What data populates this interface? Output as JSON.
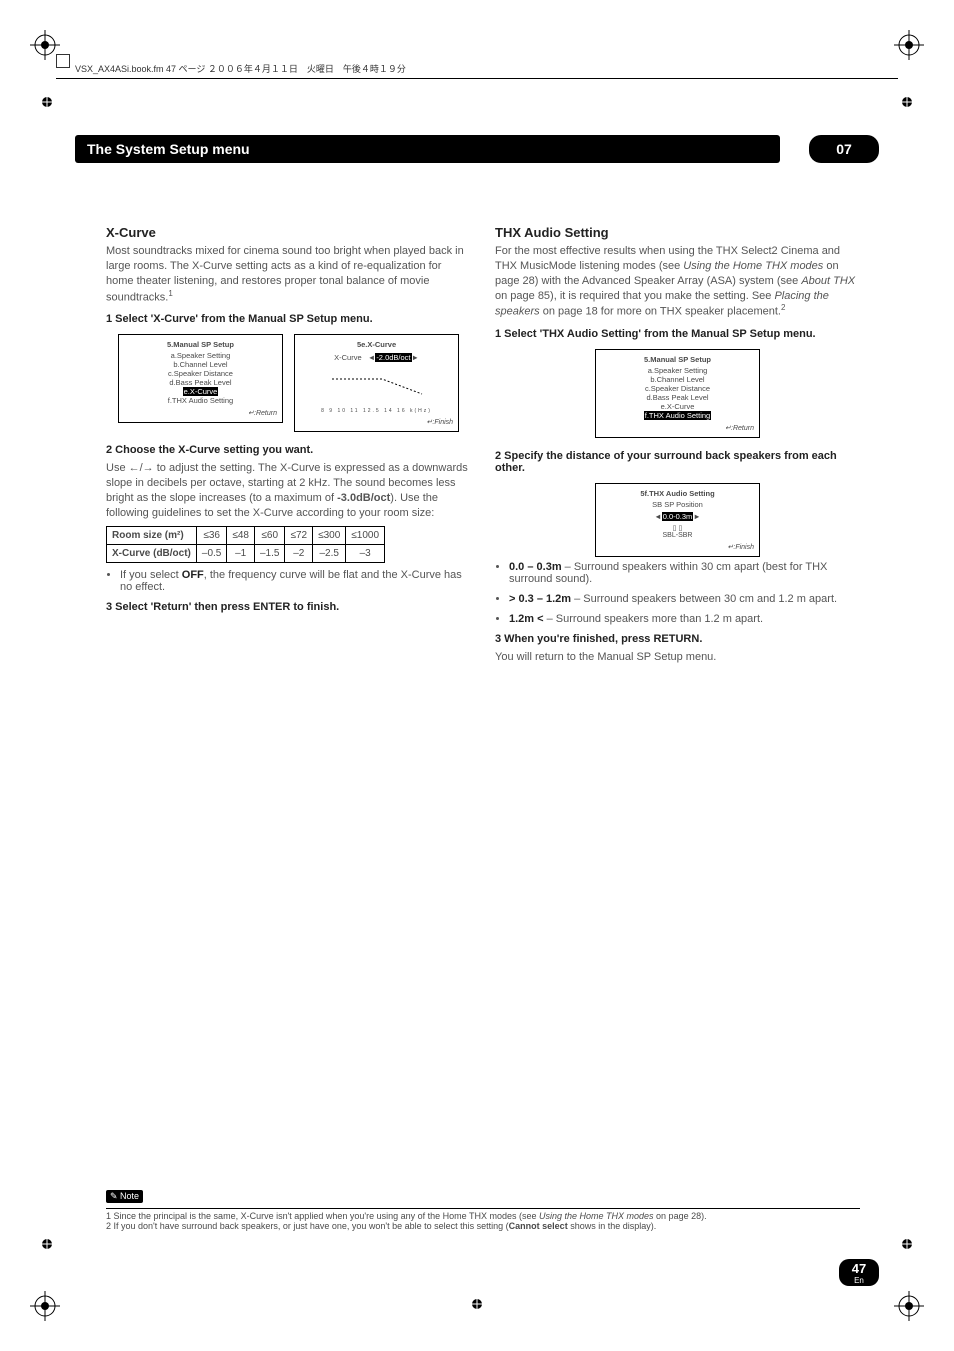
{
  "header": {
    "text": "VSX_AX4ASi.book.fm  47 ページ  ２００６年４月１１日　火曜日　午後４時１９分"
  },
  "titleBar": "The System Setup menu",
  "chapterNum": "07",
  "left": {
    "heading": "X-Curve",
    "intro": "Most soundtracks mixed for cinema sound too bright when played back in large rooms. The X-Curve setting acts as a kind of re-equalization for home theater listening, and restores proper tonal balance of movie soundtracks.",
    "introSup": "1",
    "step1": "1   Select 'X-Curve' from the Manual SP Setup menu.",
    "menu1": {
      "header": "5.Manual  SP  Setup",
      "items": [
        "a.Speaker  Setting",
        "b.Channel  Level",
        "c.Speaker  Distance",
        "d.Bass  Peak  Level",
        "e.X-Curve",
        "f.THX Audio Setting"
      ],
      "selectedIdx": 4,
      "ret": "↵:Return"
    },
    "menu2": {
      "header": "5e.X-Curve",
      "label": "X-Curve",
      "value": "-2.0dB/oct",
      "axis": "8 9 10 11 12.5 14 16 k(Hz)",
      "ret": "↵:Finish"
    },
    "step2": "2   Choose the X-Curve setting you want.",
    "step2body": "Use ←/→ to adjust the setting. The X-Curve is expressed as a downwards slope in decibels per octave, starting at 2 kHz. The sound becomes less bright as the slope increases (to a maximum of ",
    "step2bold": "-3.0dB/oct",
    "step2body2": "). Use the following guidelines to set the X-Curve according to your room size:",
    "bullet1": "If you select ",
    "bullet1bold": "OFF",
    "bullet1tail": ", the frequency curve will be flat and the X-Curve has no effect.",
    "step3": "3   Select 'Return' then press ENTER to finish."
  },
  "right": {
    "heading": "THX Audio Setting",
    "intro1": "For the most effective results when using the THX Select2 Cinema and THX MusicMode listening modes (see ",
    "intro1it": "Using the Home THX modes",
    "intro2": " on page 28) with the Advanced Speaker Array (ASA) system (see ",
    "intro2it": "About THX",
    "intro3": " on page 85), it is required that you make the setting. See ",
    "intro3it": "Placing the speakers",
    "intro4": " on page 18 for more on THX speaker placement.",
    "introSup": "2",
    "step1": "1   Select 'THX Audio Setting' from the Manual SP Setup menu.",
    "menu1": {
      "header": "5.Manual  SP  Setup",
      "items": [
        "a.Speaker  Setting",
        "b.Channel  Level",
        "c.Speaker  Distance",
        "d.Bass  Peak  Level",
        "e.X-Curve",
        "f.THX Audio Setting"
      ],
      "selectedIdx": 5,
      "ret": "↵:Return"
    },
    "step2": "2   Specify the distance of your surround back speakers from each other.",
    "menu2": {
      "header": "5f.THX  Audio  Setting",
      "sub": "SB  SP  Position",
      "value": "0.0-0.3m",
      "diag": "▯ ▯\nSBL-SBR",
      "ret": "↵:Finish"
    },
    "bullets": [
      {
        "b": "0.0 – 0.3m",
        "t": " – Surround speakers within 30 cm apart (best for THX surround sound)."
      },
      {
        "b": "> 0.3 – 1.2m",
        "t": " – Surround speakers between 30 cm and 1.2 m apart."
      },
      {
        "b": "1.2m <",
        "t": " – Surround speakers more than 1.2 m apart."
      }
    ],
    "step3": "3   When you're finished, press RETURN.",
    "step3body": "You will return to the Manual SP Setup menu."
  },
  "chart_data": {
    "type": "table",
    "headers": [
      "Room size (m²)",
      "≤36",
      "≤48",
      "≤60",
      "≤72",
      "≤300",
      "≤1000"
    ],
    "row": [
      "X-Curve (dB/oct)",
      "–0.5",
      "–1",
      "–1.5",
      "–2",
      "–2.5",
      "–3"
    ]
  },
  "notes": {
    "label": "Note",
    "n1": "1 Since the principal is the same, X-Curve isn't applied when you're using any of the Home THX modes (see ",
    "n1it": "Using the Home THX modes",
    "n1tail": " on page 28).",
    "n2": "2 If you don't have surround back speakers, or just have one, you won't be able to select this setting (",
    "n2bold": "Cannot select",
    "n2tail": " shows in the display)."
  },
  "pageNum": "47",
  "pageLang": "En"
}
